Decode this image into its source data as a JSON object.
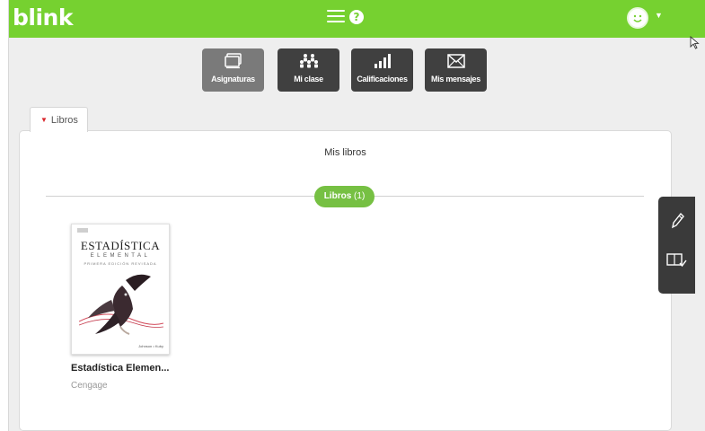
{
  "app": {
    "logo": "blink"
  },
  "topbar": {
    "help_icon": "help-circle-icon",
    "menu_icon": "hamburger-menu-icon",
    "avatar_icon": "smiley-avatar-icon",
    "accent": "#76d130"
  },
  "nav": {
    "items": [
      {
        "label": "Asignaturas",
        "icon": "books-icon",
        "active": true
      },
      {
        "label": "Mi clase",
        "icon": "people-icon",
        "active": false
      },
      {
        "label": "Calificaciones",
        "icon": "bar-chart-icon",
        "active": false
      },
      {
        "label": "Mis mensajes",
        "icon": "envelope-icon",
        "active": false
      }
    ]
  },
  "tab": {
    "label": "Libros"
  },
  "panel": {
    "title": "Mis libros",
    "section_label": "Libros",
    "section_count": "(1)"
  },
  "book": {
    "title": "Estadística Elemen...",
    "publisher": "Cengage",
    "cover": {
      "line1": "ESTADÍSTICA",
      "line2": "ELEMENTAL",
      "line3": "PRIMERA EDICIÓN REVISADA",
      "authors": "Johnson • Kuby"
    }
  },
  "sidebar": {
    "edit_icon": "pencil-icon",
    "book_check_icon": "book-check-icon"
  }
}
